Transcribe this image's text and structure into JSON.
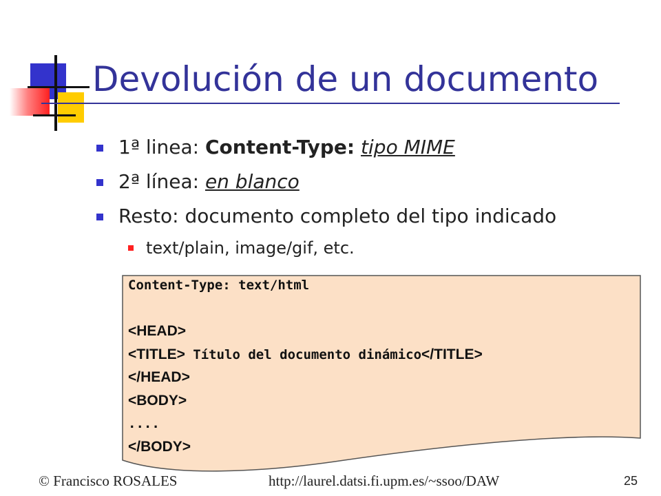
{
  "slide": {
    "title": "Devolución de un documento",
    "bullets": [
      {
        "prefix": "1ª linea: ",
        "bold": "Content-Type:",
        "space": " ",
        "italic_underlined": "tipo MIME"
      },
      {
        "prefix": "2ª línea: ",
        "italic_underlined": "en blanco"
      },
      {
        "text": "Resto: documento completo del tipo indicado"
      }
    ],
    "sub_bullet": "text/plain, image/gif, etc.",
    "code": {
      "line1": "Content-Type: text/html",
      "head_open": "<HEAD>",
      "title_open": "<TITLE>",
      "title_text": " Título del documento dinámico",
      "title_close": "</TITLE>",
      "head_close": "</HEAD>",
      "body_open": "<BODY>",
      "dots": "....",
      "body_close": "</BODY>"
    },
    "colors": {
      "title": "#333399",
      "bullet": "#3333cc",
      "sub_bullet": "#ff2020",
      "code_bg": "#fce0c6"
    }
  },
  "footer": {
    "author": "© Francisco ROSALES",
    "url": "http://laurel.datsi.fi.upm.es/~ssoo/DAW",
    "page": "25"
  }
}
